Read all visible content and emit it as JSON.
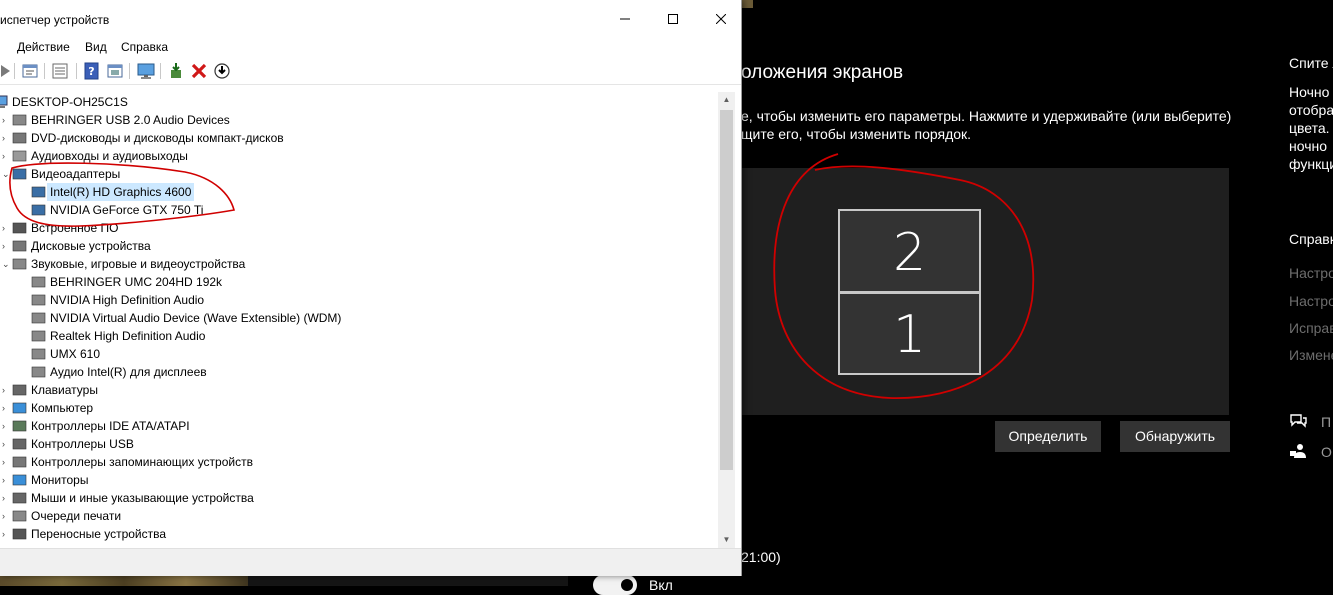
{
  "settings": {
    "title": "оложения экранов",
    "description_line1": "е, чтобы изменить его параметры. Нажмите и удерживайте (или выберите)",
    "description_line2": "щите его, чтобы изменить порядок.",
    "monitors": [
      {
        "label": "2"
      },
      {
        "label": "1"
      }
    ],
    "identify_button": "Определить",
    "detect_button": "Обнаружить",
    "time_fragment": "21:00)",
    "toggle_label_fragment": "Вкл",
    "right_column": {
      "heading1": "Спите л",
      "para": [
        "Ночно",
        "отобра",
        "цвета.",
        "ночно",
        "функци"
      ],
      "heading2": "Справк",
      "links": [
        "Настро",
        "Настро",
        "Исправ",
        "Измене"
      ],
      "icon_items": [
        "П",
        "О"
      ]
    }
  },
  "devmgr": {
    "title": "испетчер устройств",
    "window_controls": {
      "minimize": "—",
      "maximize": "☐",
      "close": "✕"
    },
    "menu": [
      "Действие",
      "Вид",
      "Справка"
    ],
    "toolbar_icons": [
      "back-icon",
      "properties-icon",
      "list-icon",
      "help-icon",
      "update-view-icon",
      "monitor-icon",
      "add-driver-icon",
      "uninstall-icon",
      "download-icon"
    ],
    "tree": {
      "root": "DESKTOP-OH25C1S",
      "items": [
        {
          "label": "BEHRINGER USB 2.0 Audio Devices",
          "level": 1,
          "expander": ">"
        },
        {
          "label": "DVD-дисководы и дисководы компакт-дисков",
          "level": 1,
          "expander": ">"
        },
        {
          "label": "Аудиовходы и аудиовыходы",
          "level": 1,
          "expander": ">"
        },
        {
          "label": "Видеоадаптеры",
          "level": 1,
          "expander": "v"
        },
        {
          "label": "Intel(R) HD Graphics 4600",
          "level": 2,
          "selected": true
        },
        {
          "label": "NVIDIA GeForce GTX 750 Ti",
          "level": 2
        },
        {
          "label": "Встроенное ПО",
          "level": 1,
          "expander": ">"
        },
        {
          "label": "Дисковые устройства",
          "level": 1,
          "expander": ">"
        },
        {
          "label": "Звуковые, игровые и видеоустройства",
          "level": 1,
          "expander": "v"
        },
        {
          "label": "BEHRINGER UMC 204HD 192k",
          "level": 2
        },
        {
          "label": "NVIDIA High Definition Audio",
          "level": 2
        },
        {
          "label": "NVIDIA Virtual Audio Device (Wave Extensible) (WDM)",
          "level": 2
        },
        {
          "label": "Realtek High Definition Audio",
          "level": 2
        },
        {
          "label": "UMX 610",
          "level": 2
        },
        {
          "label": "Аудио Intel(R) для дисплеев",
          "level": 2
        },
        {
          "label": "Клавиатуры",
          "level": 1,
          "expander": ">"
        },
        {
          "label": "Компьютер",
          "level": 1,
          "expander": ">"
        },
        {
          "label": "Контроллеры IDE ATA/ATAPI",
          "level": 1,
          "expander": ">"
        },
        {
          "label": "Контроллеры USB",
          "level": 1,
          "expander": ">"
        },
        {
          "label": "Контроллеры запоминающих устройств",
          "level": 1,
          "expander": ">"
        },
        {
          "label": "Мониторы",
          "level": 1,
          "expander": ">"
        },
        {
          "label": "Мыши и иные указывающие устройства",
          "level": 1,
          "expander": ">"
        },
        {
          "label": "Очереди печати",
          "level": 1,
          "expander": ">"
        },
        {
          "label": "Переносные устройства",
          "level": 1,
          "expander": ">"
        }
      ]
    }
  },
  "colors": {
    "annotation": "#d00000",
    "selection": "#cce8ff",
    "dark_button": "#333333"
  }
}
